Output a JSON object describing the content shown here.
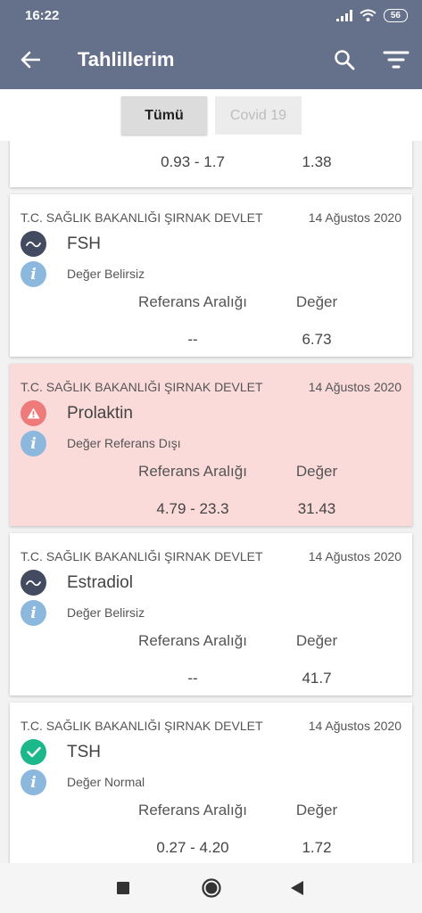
{
  "status_bar": {
    "time": "16:22",
    "battery": "56"
  },
  "app_bar": {
    "title": "Tahlillerim"
  },
  "tabs": [
    {
      "label": "Tümü",
      "selected": true
    },
    {
      "label": "Covid 19",
      "selected": false
    }
  ],
  "columns": {
    "reference": "Referans Aralığı",
    "value": "Değer"
  },
  "partial_card": {
    "reference": "0.93 - 1.7",
    "value": "1.38"
  },
  "cards": [
    {
      "hospital": "T.C. SAĞLIK BAKANLIĞI ŞIRNAK DEVLET",
      "date": "14 Ağustos 2020",
      "name": "FSH",
      "status": "Değer Belirsiz",
      "reference": "--",
      "value": "6.73"
    },
    {
      "hospital": "T.C. SAĞLIK BAKANLIĞI ŞIRNAK DEVLET",
      "date": "14 Ağustos 2020",
      "name": "Prolaktin",
      "status": "Değer Referans Dışı",
      "reference": "4.79 - 23.3",
      "value": "31.43"
    },
    {
      "hospital": "T.C. SAĞLIK BAKANLIĞI ŞIRNAK DEVLET",
      "date": "14 Ağustos 2020",
      "name": "Estradiol",
      "status": "Değer Belirsiz",
      "reference": "--",
      "value": "41.7"
    },
    {
      "hospital": "T.C. SAĞLIK BAKANLIĞI ŞIRNAK DEVLET",
      "date": "14 Ağustos 2020",
      "name": "TSH",
      "status": "Değer Normal",
      "reference": "0.27 - 4.20",
      "value": "1.72"
    }
  ],
  "icons": {
    "unknown": "wave-icon",
    "warning": "warning-triangle-icon",
    "ok": "check-icon",
    "info": "info-icon"
  },
  "colors": {
    "app_bar": "#65708a",
    "alert_card": "#fbdada",
    "icon_unknown": "#434b61",
    "icon_warning": "#ee7a7a",
    "icon_ok": "#1ab88a",
    "icon_info": "#8db8de"
  }
}
